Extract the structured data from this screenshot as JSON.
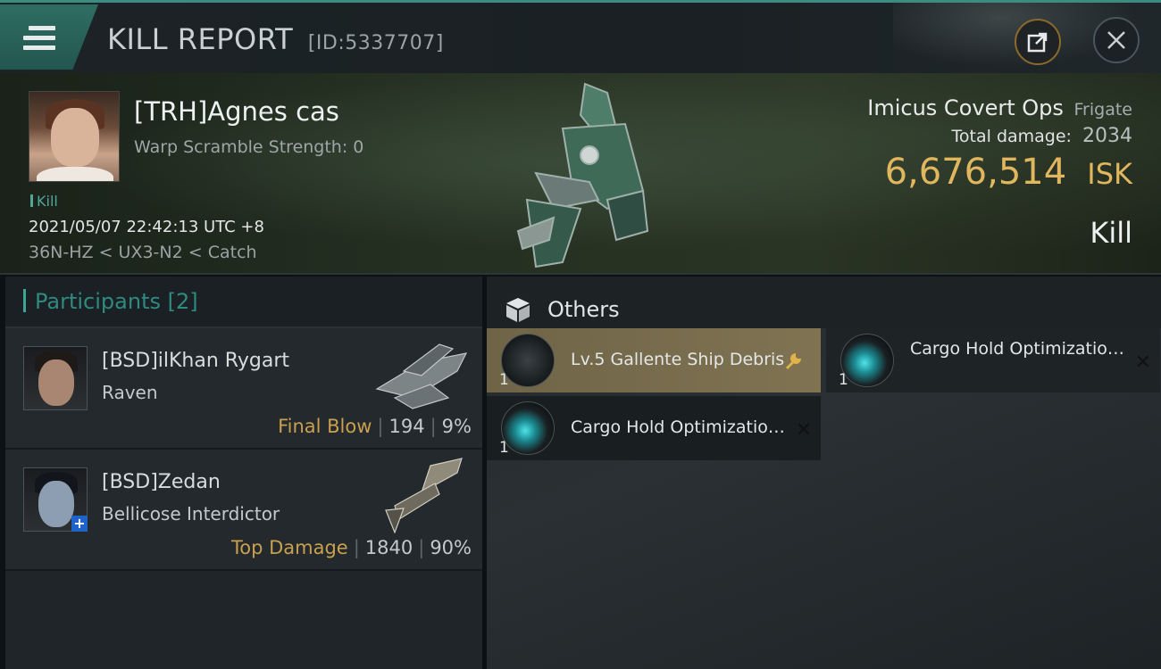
{
  "header": {
    "title": "KILL REPORT",
    "report_id": "[ID:5337707]",
    "icons": {
      "menu": "hamburger-menu-icon",
      "share": "share-external-icon",
      "close": "close-icon"
    }
  },
  "victim": {
    "name": "[TRH]Agnes cas",
    "warp_scramble": "Warp Scramble Strength: 0",
    "kill_tag": "Kill",
    "datetime": "2021/05/07 22:42:13 UTC +8",
    "location": "36N-HZ < UX3-N2 < Catch",
    "ship_name": "Imicus Covert Ops",
    "ship_class": "Frigate",
    "total_damage_label": "Total damage:",
    "total_damage_value": "2034",
    "isk_value": "6,676,514",
    "isk_unit": "ISK",
    "result": "Kill"
  },
  "participants": {
    "title": "Participants",
    "count": "[2]",
    "items": [
      {
        "name": "[BSD]ilKhan Rygart",
        "ship": "Raven",
        "role": "Final Blow",
        "damage": "194",
        "percent": "9%"
      },
      {
        "name": "[BSD]Zedan",
        "ship": "Bellicose Interdictor",
        "role": "Top Damage",
        "damage": "1840",
        "percent": "90%"
      }
    ]
  },
  "others": {
    "title": "Others",
    "items": [
      {
        "qty": "1",
        "name": "Lv.5 Gallente Ship Debris",
        "marker": "wrench-icon"
      },
      {
        "qty": "1",
        "name": "Cargo Hold Optimization...",
        "marker": "x-mark-icon"
      },
      {
        "qty": "1",
        "name": "Cargo Hold Optimization...",
        "marker": "x-mark-icon"
      }
    ]
  },
  "colors": {
    "accent": "#3a8d80",
    "gold": "#e0b65e",
    "role": "#c9a04e"
  }
}
